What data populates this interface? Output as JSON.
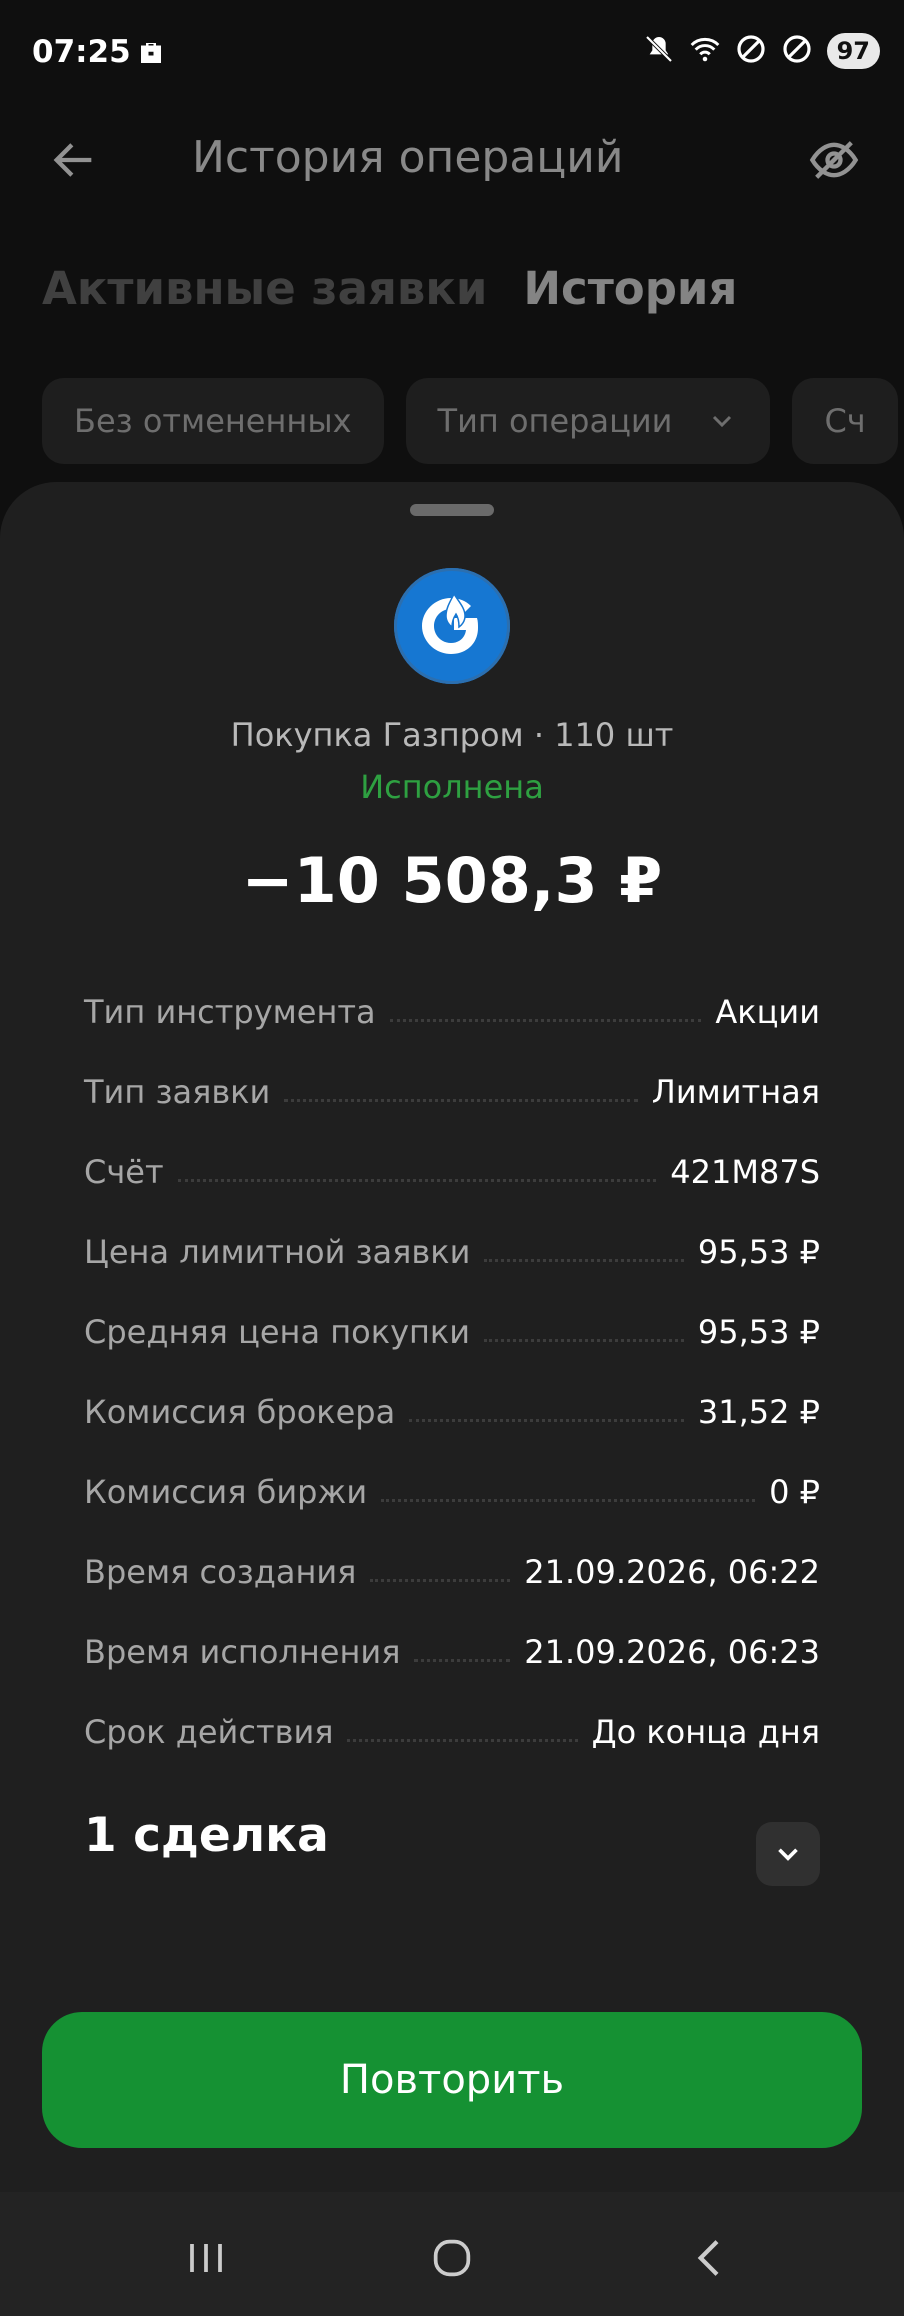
{
  "status_bar": {
    "time": "07:25",
    "battery": "97",
    "icons": [
      "briefcase-icon",
      "mute-icon",
      "wifi-icon",
      "block-icon",
      "block-icon"
    ]
  },
  "header": {
    "title": "История операций",
    "back_icon": "arrow-left-icon",
    "visibility_icon": "eye-off-icon"
  },
  "tabs": [
    {
      "label": "Активные заявки",
      "active": false
    },
    {
      "label": "История",
      "active": true
    }
  ],
  "filters": [
    {
      "label": "Без отмененных"
    },
    {
      "label": "Тип операции"
    },
    {
      "label": "Сч"
    }
  ],
  "sheet": {
    "operation_title": "Покупка Газпром · 110 шт",
    "status": "Исполнена",
    "amount": "−10 508,3 ₽",
    "details": [
      {
        "label": "Тип инструмента",
        "value": "Акции"
      },
      {
        "label": "Тип заявки",
        "value": "Лимитная"
      },
      {
        "label": "Счёт",
        "value": "421M87S"
      },
      {
        "label": "Цена лимитной заявки",
        "value": "95,53 ₽"
      },
      {
        "label": "Средняя цена покупки",
        "value": "95,53 ₽"
      },
      {
        "label": "Комиссия брокера",
        "value": "31,52 ₽"
      },
      {
        "label": "Комиссия биржи",
        "value": "0 ₽"
      },
      {
        "label": "Время создания",
        "value": "21.09.2026, 06:22"
      },
      {
        "label": "Время исполнения",
        "value": "21.09.2026, 06:23"
      },
      {
        "label": "Срок действия",
        "value": "До конца дня"
      }
    ],
    "deals_label": "1 сделка",
    "repeat_button": "Повторить"
  },
  "colors": {
    "accent_green": "#159133",
    "status_green": "#2ea041",
    "logo_blue": "#1677d2"
  }
}
